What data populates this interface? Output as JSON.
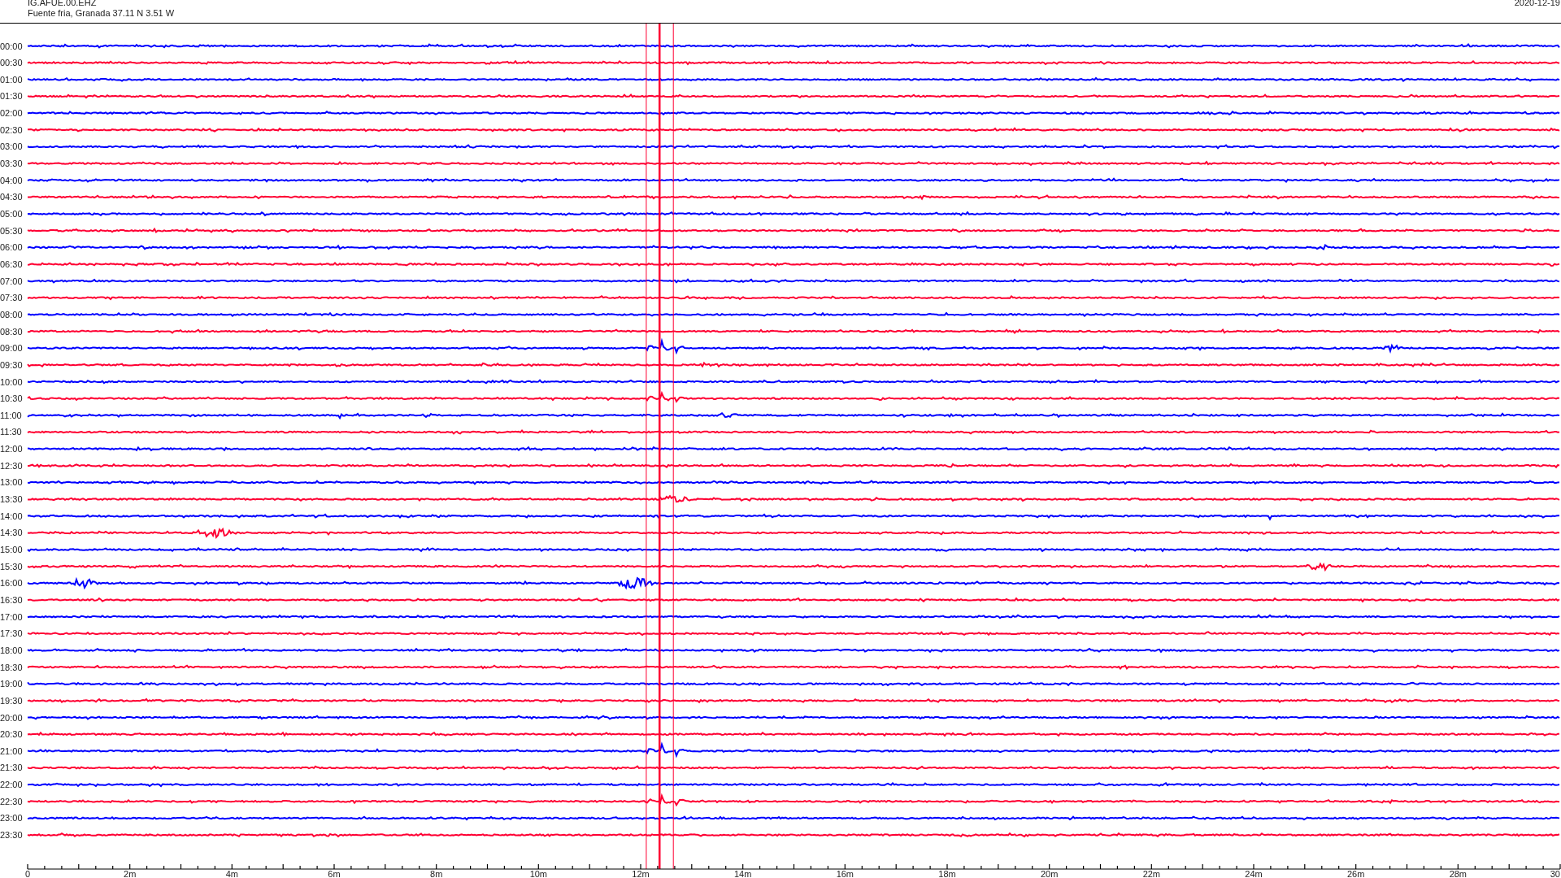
{
  "header": {
    "station": "IG.AFUE.00.EHZ",
    "location": "Fuente fria, Granada  37.11 N 3.51 W",
    "date": "2020-12-19"
  },
  "rows": [
    {
      "time": "00:00",
      "color": "#0000ff"
    },
    {
      "time": "00:30",
      "color": "#ff0033"
    },
    {
      "time": "01:00",
      "color": "#0000ff"
    },
    {
      "time": "01:30",
      "color": "#ff0033"
    },
    {
      "time": "02:00",
      "color": "#0000ff"
    },
    {
      "time": "02:30",
      "color": "#ff0033"
    },
    {
      "time": "03:00",
      "color": "#0000ff"
    },
    {
      "time": "03:30",
      "color": "#ff0033"
    },
    {
      "time": "04:00",
      "color": "#0000ff"
    },
    {
      "time": "04:30",
      "color": "#ff0033"
    },
    {
      "time": "05:00",
      "color": "#0000ff"
    },
    {
      "time": "05:30",
      "color": "#ff0033"
    },
    {
      "time": "06:00",
      "color": "#0000ff"
    },
    {
      "time": "06:30",
      "color": "#ff0033"
    },
    {
      "time": "07:00",
      "color": "#0000ff"
    },
    {
      "time": "07:30",
      "color": "#ff0033"
    },
    {
      "time": "08:00",
      "color": "#0000ff"
    },
    {
      "time": "08:30",
      "color": "#ff0033"
    },
    {
      "time": "09:00",
      "color": "#0000ff"
    },
    {
      "time": "09:30",
      "color": "#ff0033"
    },
    {
      "time": "10:00",
      "color": "#0000ff"
    },
    {
      "time": "10:30",
      "color": "#ff0033"
    },
    {
      "time": "11:00",
      "color": "#0000ff"
    },
    {
      "time": "11:30",
      "color": "#ff0033"
    },
    {
      "time": "12:00",
      "color": "#0000ff"
    },
    {
      "time": "12:30",
      "color": "#ff0033"
    },
    {
      "time": "13:00",
      "color": "#0000ff"
    },
    {
      "time": "13:30",
      "color": "#ff0033"
    },
    {
      "time": "14:00",
      "color": "#0000ff"
    },
    {
      "time": "14:30",
      "color": "#ff0033"
    },
    {
      "time": "15:00",
      "color": "#0000ff"
    },
    {
      "time": "15:30",
      "color": "#ff0033"
    },
    {
      "time": "16:00",
      "color": "#0000ff"
    },
    {
      "time": "16:30",
      "color": "#ff0033"
    },
    {
      "time": "17:00",
      "color": "#0000ff"
    },
    {
      "time": "17:30",
      "color": "#ff0033"
    },
    {
      "time": "18:00",
      "color": "#0000ff"
    },
    {
      "time": "18:30",
      "color": "#ff0033"
    },
    {
      "time": "19:00",
      "color": "#0000ff"
    },
    {
      "time": "19:30",
      "color": "#ff0033"
    },
    {
      "time": "20:00",
      "color": "#0000ff"
    },
    {
      "time": "20:30",
      "color": "#ff0033"
    },
    {
      "time": "21:00",
      "color": "#0000ff"
    },
    {
      "time": "21:30",
      "color": "#ff0033"
    },
    {
      "time": "22:00",
      "color": "#0000ff"
    },
    {
      "time": "22:30",
      "color": "#ff0033"
    },
    {
      "time": "23:00",
      "color": "#0000ff"
    },
    {
      "time": "23:30",
      "color": "#ff0033"
    }
  ],
  "x_axis": {
    "labels": [
      "0",
      "2m",
      "4m",
      "6m",
      "8m",
      "10m",
      "12m",
      "14m",
      "16m",
      "18m",
      "20m",
      "22m",
      "24m",
      "26m",
      "28m",
      "30"
    ]
  }
}
